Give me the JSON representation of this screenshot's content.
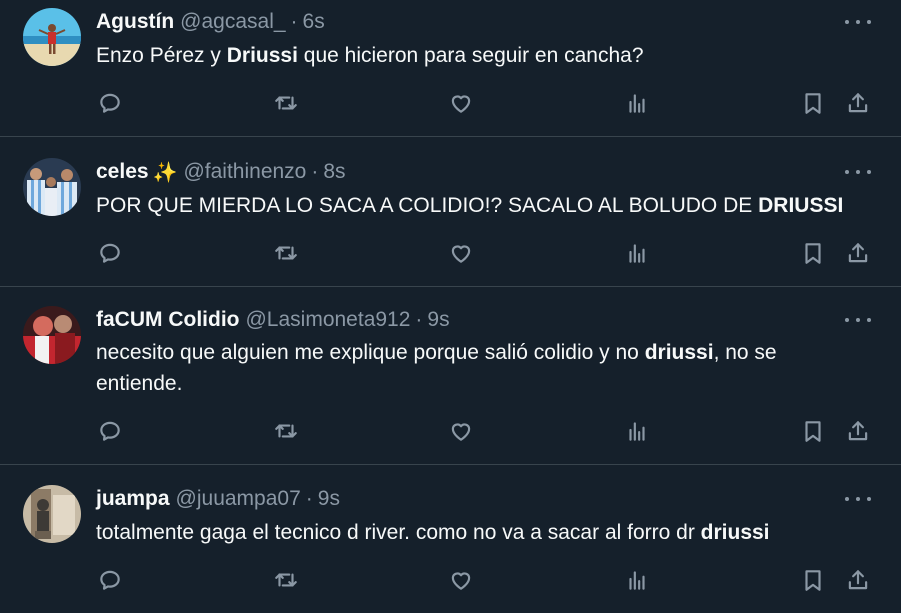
{
  "tweets": [
    {
      "name": "Agustín",
      "emoji": "",
      "handle": "@agcasal_",
      "separator": "·",
      "time": "6s",
      "segments": [
        {
          "text": "Enzo Pérez y ",
          "bold": false
        },
        {
          "text": "Driussi",
          "bold": true
        },
        {
          "text": " que hicieron para seguir en cancha?",
          "bold": false
        }
      ],
      "avatar_colors": [
        "#4bb3e0",
        "#e6d4a8",
        "#c9302c"
      ]
    },
    {
      "name": "celes",
      "emoji": "✨",
      "handle": "@faithinenzo",
      "separator": "·",
      "time": "8s",
      "segments": [
        {
          "text": "POR QUE MIERDA LO SACA A COLIDIO!? SACALO AL BOLUDO DE ",
          "bold": false
        },
        {
          "text": "DRIUSSI",
          "bold": true
        }
      ],
      "avatar_colors": [
        "#d7e6f3",
        "#6fa8dc",
        "#1f2a3a"
      ]
    },
    {
      "name": "faCUM Colidio",
      "emoji": "",
      "handle": "@Lasimoneta912",
      "separator": "·",
      "time": "9s",
      "segments": [
        {
          "text": "necesito que alguien me explique porque salió colidio y no ",
          "bold": false
        },
        {
          "text": "driussi",
          "bold": true
        },
        {
          "text": ", no se entiende.",
          "bold": false
        }
      ],
      "avatar_colors": [
        "#c3262f",
        "#f2f2f2",
        "#8a1a1f"
      ]
    },
    {
      "name": "juampa",
      "emoji": "",
      "handle": "@juuampa07",
      "separator": "·",
      "time": "9s",
      "segments": [
        {
          "text": "totalmente gaga el tecnico d river. como no va a sacar al forro dr ",
          "bold": false
        },
        {
          "text": "driussi",
          "bold": true
        }
      ],
      "avatar_colors": [
        "#8c7b66",
        "#3d3a36",
        "#c7bba6"
      ]
    }
  ],
  "icons": {
    "reply": "reply-icon",
    "retweet": "retweet-icon",
    "like": "like-icon",
    "views": "views-icon",
    "bookmark": "bookmark-icon",
    "share": "share-icon",
    "more": "more-icon"
  },
  "colors": {
    "background": "#15202b",
    "divider": "#38444d",
    "primary_text": "#f7f9f9",
    "secondary_text": "#8b98a5"
  }
}
